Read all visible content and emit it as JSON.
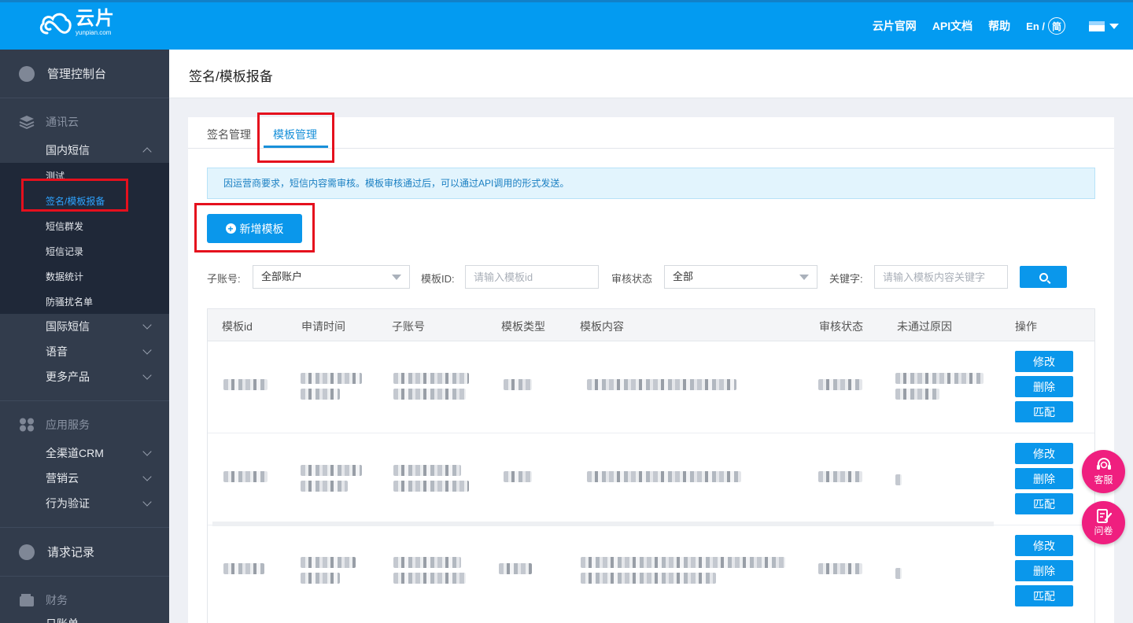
{
  "brand": {
    "name_cn": "云片",
    "name_en": "yunpian.com"
  },
  "topnav": {
    "links": [
      "云片官网",
      "API文档",
      "帮助"
    ],
    "lang_en": "En /",
    "lang_cn": "简"
  },
  "sidebar": {
    "dashboard": "管理控制台",
    "group_comm": "通讯云",
    "domestic_sms": "国内短信",
    "sub_items": [
      "测试",
      "签名/模板报备",
      "短信群发",
      "短信记录",
      "数据统计",
      "防骚扰名单"
    ],
    "more_comm": [
      "国际短信",
      "语音",
      "更多产品"
    ],
    "group_app": "应用服务",
    "app_items": [
      "全渠道CRM",
      "营销云",
      "行为验证"
    ],
    "request_log": "请求记录",
    "group_finance": "财务",
    "finance_items": [
      "日账单"
    ]
  },
  "page": {
    "title": "签名/模板报备"
  },
  "tabs": [
    {
      "label": "签名管理",
      "active": false
    },
    {
      "label": "模板管理",
      "active": true
    }
  ],
  "notice": "因运营商要求，短信内容需审核。模板审核通过后，可以通过API调用的形式发送。",
  "add_button": "新增模板",
  "filters": {
    "subaccount_label": "子账号:",
    "subaccount_value": "全部账户",
    "template_id_label": "模板ID:",
    "template_id_placeholder": "请输入模板id",
    "status_label": "审核状态",
    "status_value": "全部",
    "keyword_label": "关键字:",
    "keyword_placeholder": "请输入模板内容关键字"
  },
  "table": {
    "columns": [
      "模板id",
      "申请时间",
      "子账号",
      "模板类型",
      "模板内容",
      "审核状态",
      "未通过原因",
      "操作"
    ],
    "row_actions": [
      "修改",
      "删除",
      "匹配"
    ],
    "row_count": 3
  },
  "floating": {
    "service": "客服",
    "survey": "问卷"
  },
  "colors": {
    "topbar": "#039bf1",
    "sidebar": "#323c4c",
    "accent": "#0a97eb",
    "highlight": "#e5101d",
    "float": "#ef1f7f"
  }
}
